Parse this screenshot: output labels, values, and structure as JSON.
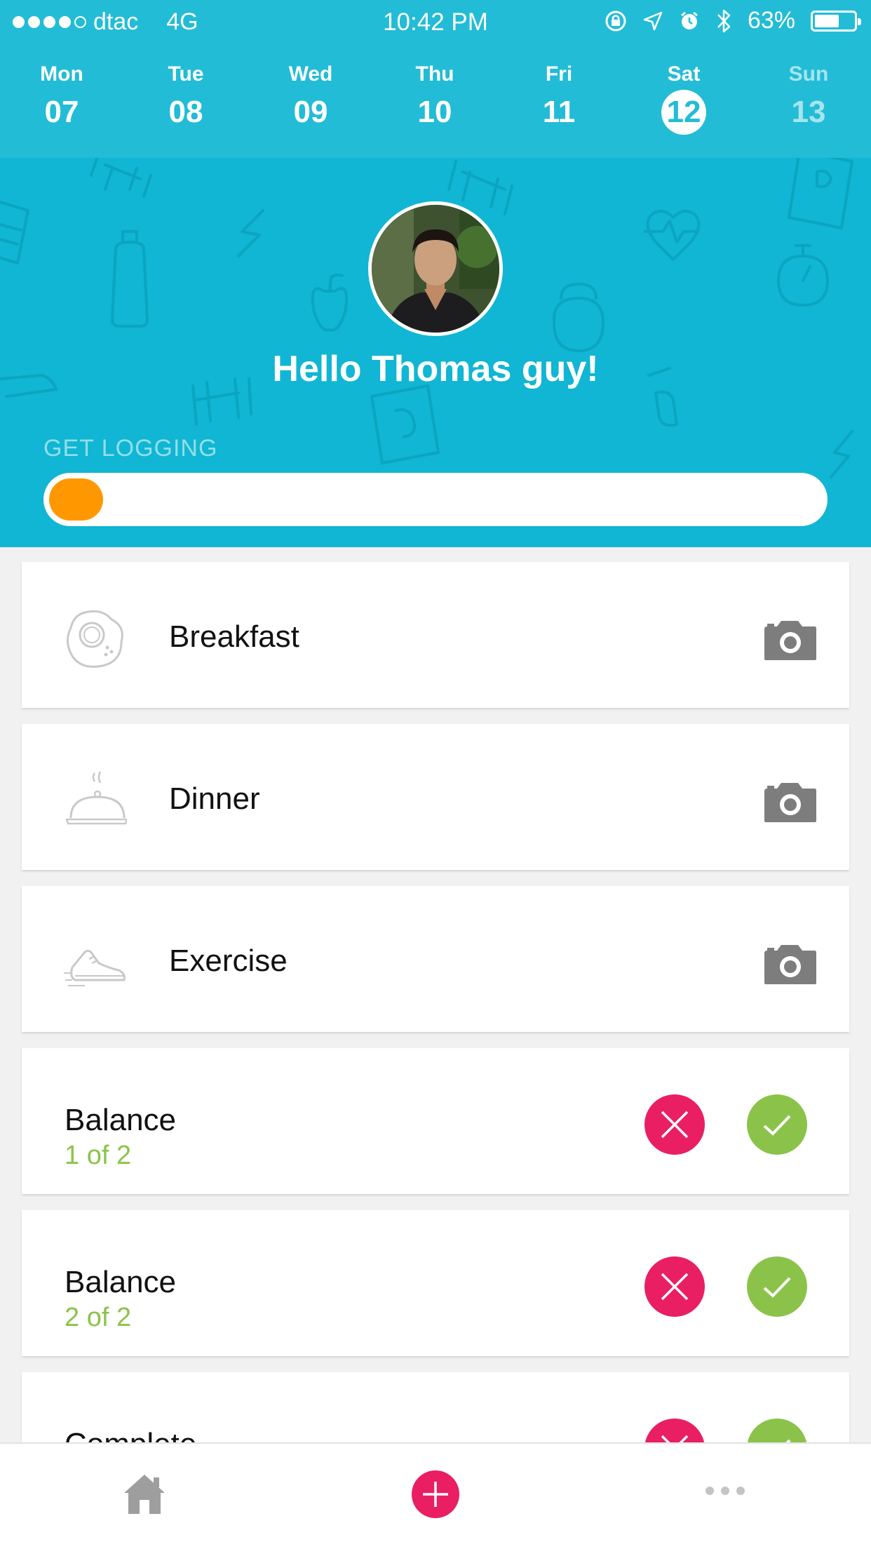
{
  "status_bar": {
    "carrier": "dtac",
    "network": "4G",
    "time": "10:42 PM",
    "battery": "63%",
    "battery_level": 0.63,
    "signal_bars_filled": 4,
    "signal_bars_total": 5
  },
  "week": [
    {
      "name": "Mon",
      "num": "07",
      "state": "normal"
    },
    {
      "name": "Tue",
      "num": "08",
      "state": "normal"
    },
    {
      "name": "Wed",
      "num": "09",
      "state": "normal"
    },
    {
      "name": "Thu",
      "num": "10",
      "state": "normal"
    },
    {
      "name": "Fri",
      "num": "11",
      "state": "normal"
    },
    {
      "name": "Sat",
      "num": "12",
      "state": "selected"
    },
    {
      "name": "Sun",
      "num": "13",
      "state": "faded"
    }
  ],
  "profile": {
    "greeting": "Hello Thomas guy!"
  },
  "logging": {
    "label": "GET LOGGING",
    "progress_fraction": 0.07
  },
  "entries": [
    {
      "kind": "log",
      "icon": "egg-icon",
      "title": "Breakfast"
    },
    {
      "kind": "log",
      "icon": "cloche-icon",
      "title": "Dinner"
    },
    {
      "kind": "log",
      "icon": "sneaker-icon",
      "title": "Exercise"
    }
  ],
  "habits": [
    {
      "title": "Balance",
      "sub": "1 of 2"
    },
    {
      "title": "Balance",
      "sub": "2 of 2"
    },
    {
      "title": "Complete",
      "sub": ""
    }
  ],
  "tabbar": {
    "home": "home-icon",
    "add": "plus-icon",
    "more": "more-icon"
  },
  "colors": {
    "header": "#22bcd6",
    "hero": "#10b6d3",
    "progress": "#ff9800",
    "reject": "#e91e63",
    "accept": "#8bc34a"
  }
}
